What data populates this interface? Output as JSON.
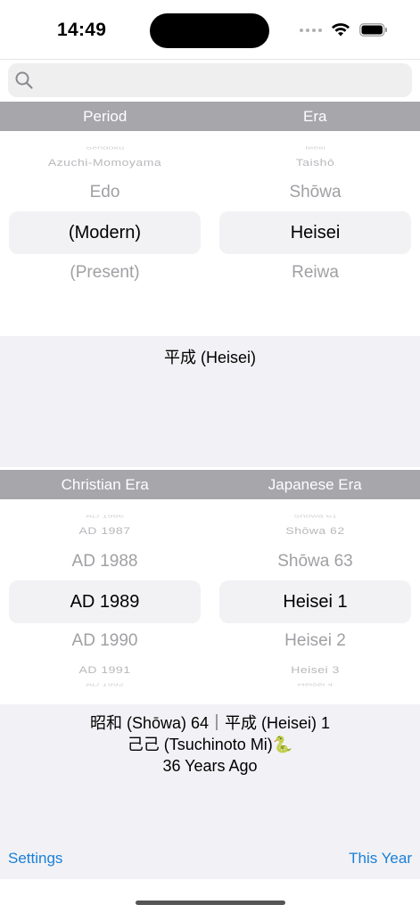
{
  "status_bar": {
    "time": "14:49"
  },
  "search": {
    "placeholder": "",
    "value": ""
  },
  "era_picker": {
    "headers": {
      "left": "Period",
      "right": "Era"
    },
    "left_wheel": {
      "far_above": "Sengoku",
      "above_2": "Azuchi-Momoyama",
      "above_1": "Edo",
      "selected": "(Modern)",
      "below_1": "(Present)"
    },
    "right_wheel": {
      "far_above": "Meiji",
      "above_2": "Taishō",
      "above_1": "Shōwa",
      "selected": "Heisei",
      "below_1": "Reiwa"
    }
  },
  "era_result": "平成 (Heisei)",
  "year_picker": {
    "headers": {
      "left": "Christian Era",
      "right": "Japanese Era"
    },
    "left_wheel": {
      "far_above": "AD 1986",
      "above_2": "AD 1987",
      "above_1": "AD 1988",
      "selected": "AD 1989",
      "below_1": "AD 1990",
      "below_2": "AD 1991",
      "far_below": "AD 1992"
    },
    "right_wheel": {
      "far_above": "Shōwa 61",
      "above_2": "Shōwa 62",
      "above_1": "Shōwa 63",
      "selected": "Heisei 1",
      "below_1": "Heisei 2",
      "below_2": "Heisei 3",
      "far_below": "Heisei 4"
    }
  },
  "year_result": {
    "line1": "昭和 (Shōwa) 64｜平成 (Heisei) 1",
    "line2": "己己 (Tsuchinoto Mi)",
    "line2_emoji": "🐍",
    "line3": "36 Years Ago"
  },
  "toolbar": {
    "settings_label": "Settings",
    "this_year_label": "This Year"
  },
  "colors": {
    "accent": "#1a7fd6",
    "header_bg": "#a6a6ab",
    "panel_bg": "#f2f2f6",
    "selection_bg": "#f2f2f4"
  }
}
